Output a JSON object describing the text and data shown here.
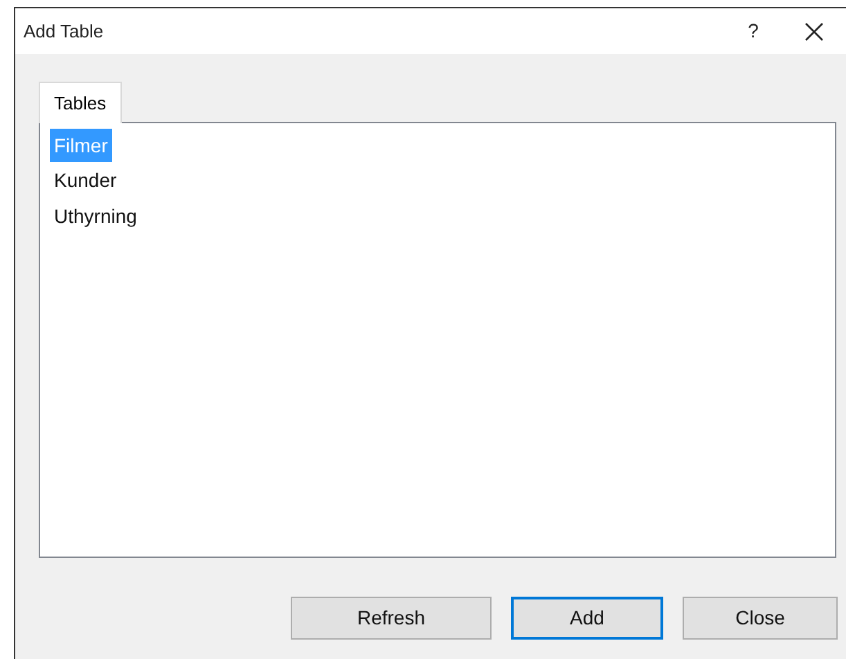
{
  "window": {
    "title": "Add Table",
    "help": "?"
  },
  "tabs": [
    {
      "label": "Tables",
      "selected": true
    }
  ],
  "tables": [
    {
      "name": "Filmer",
      "selected": true
    },
    {
      "name": "Kunder",
      "selected": false
    },
    {
      "name": "Uthyrning",
      "selected": false
    }
  ],
  "buttons": [
    {
      "label": "Refresh",
      "default": false
    },
    {
      "label": "Add",
      "default": true
    },
    {
      "label": "Close",
      "default": false
    }
  ]
}
